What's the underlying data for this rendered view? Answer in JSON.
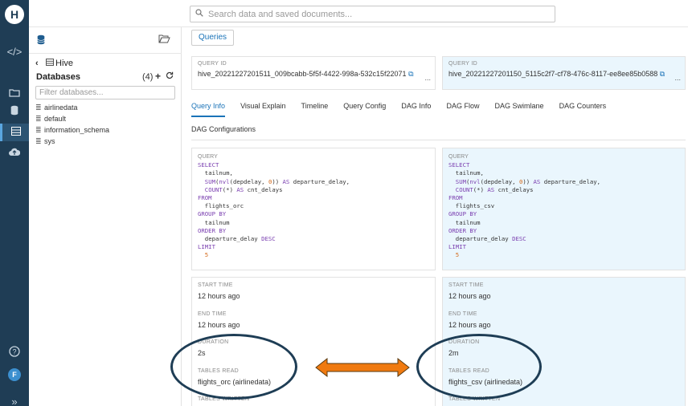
{
  "app": {
    "logo_letter": "H"
  },
  "rail": {
    "icons": [
      "code-icon",
      "folder-icon",
      "database-icon",
      "table-icon",
      "cloud-upload-icon",
      "help-icon",
      "expand-icon"
    ],
    "avatar_letter": "F",
    "expand_glyph": "»"
  },
  "search": {
    "placeholder": "Search data and saved documents..."
  },
  "db_panel": {
    "back_glyph": "‹",
    "source": "Hive",
    "databases_label": "Databases",
    "count": "(4)",
    "filter_placeholder": "Filter databases...",
    "databases": [
      "airlinedata",
      "default",
      "information_schema",
      "sys"
    ]
  },
  "main": {
    "queries_button": "Queries",
    "left": {
      "query_id_label": "QUERY ID",
      "query_id": "hive_20221227201511_009bcabb-5f5f-4422-998a-532c15f22071",
      "sql_label": "QUERY",
      "stats": [
        {
          "label": "START TIME",
          "value": "12 hours ago"
        },
        {
          "label": "END TIME",
          "value": "12 hours ago"
        },
        {
          "label": "DURATION",
          "value": "2s"
        },
        {
          "label": "TABLES READ",
          "value": "flights_orc (airlinedata)"
        },
        {
          "label": "TABLES WRITTEN",
          "value": ""
        }
      ],
      "table": "flights_orc"
    },
    "right": {
      "query_id_label": "QUERY ID",
      "query_id": "hive_20221227201150_5115c2f7-cf78-476c-8117-ee8ee85b0588",
      "sql_label": "QUERY",
      "stats": [
        {
          "label": "START TIME",
          "value": "12 hours ago"
        },
        {
          "label": "END TIME",
          "value": "12 hours ago"
        },
        {
          "label": "DURATION",
          "value": "2m"
        },
        {
          "label": "TABLES READ",
          "value": "flights_csv (airlinedata)"
        },
        {
          "label": "TABLES WRITTEN",
          "value": ""
        }
      ],
      "table": "flights_csv"
    },
    "tabs": [
      "Query Info",
      "Visual Explain",
      "Timeline",
      "Query Config",
      "DAG Info",
      "DAG Flow",
      "DAG Swimlane",
      "DAG Counters"
    ],
    "tabs_row2": [
      "DAG Configurations"
    ],
    "active_tab": "Query Info",
    "ellipsis": "..."
  },
  "sql": {
    "select": "SELECT",
    "col1": "tailnum,",
    "sum_fn": "SUM",
    "nvl_fn": "nvl",
    "nvl_arg": "depdelay",
    "zero": "0",
    "as1": "AS",
    "alias1": "departure_delay,",
    "count_fn": "COUNT",
    "star": "*",
    "as2": "AS",
    "alias2": "cnt_delays",
    "from": "FROM",
    "group_by": "GROUP BY",
    "group_col": "tailnum",
    "order_by": "ORDER BY",
    "order_col": "departure_delay",
    "desc": "DESC",
    "limit": "LIMIT",
    "limit_val": "5"
  },
  "colors": {
    "rail": "#1f3d55",
    "accent": "#1a73b8",
    "right_panel_bg": "#eaf6fd",
    "arrow": "#f07a10",
    "oval": "#1e3d55"
  }
}
